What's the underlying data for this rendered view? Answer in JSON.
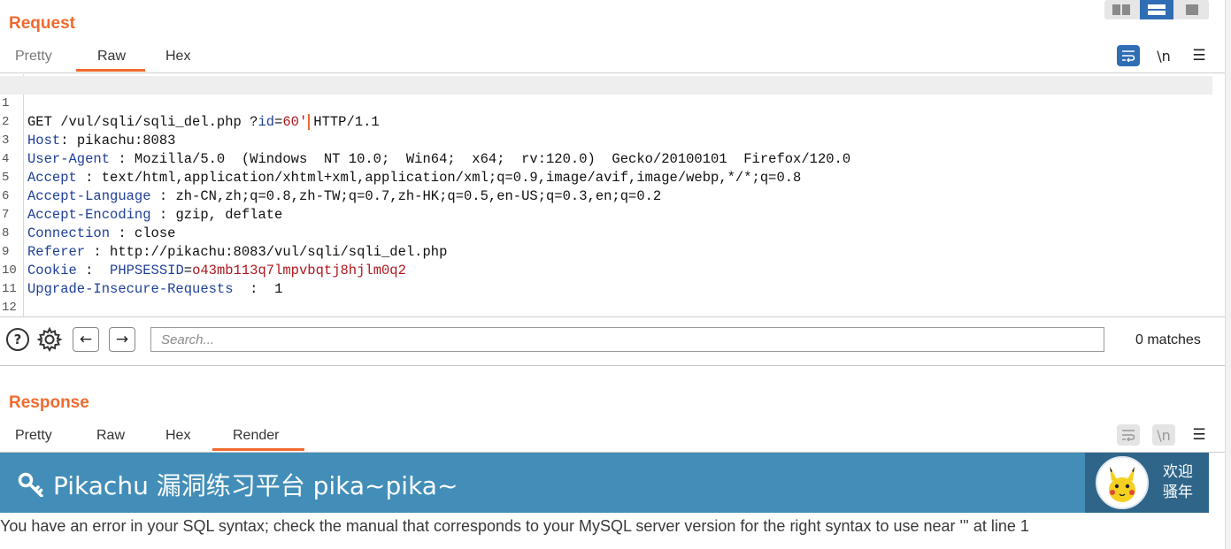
{
  "layout_toggle": {
    "options": [
      "side-by-side",
      "stacked",
      "single"
    ],
    "active": "stacked"
  },
  "request": {
    "title": "Request",
    "tabs": [
      "Pretty",
      "Raw",
      "Hex"
    ],
    "active_tab": "Raw",
    "toolbar": {
      "wrap_icon": "wrap-lines-icon",
      "newline_label": "\\n",
      "menu_label": "☰"
    },
    "lines": [
      {
        "n": "1",
        "method_path": "GET /vul/sqli/sqli_del.php ?",
        "param_key": "id",
        "eq": "=",
        "param_value": "60'",
        "after": "HTTP/1.1"
      },
      {
        "n": "2",
        "key": "Host",
        "sep": ": ",
        "value": "pikachu:8083"
      },
      {
        "n": "3",
        "key": "User-Agent",
        "sep": " : ",
        "value": "Mozilla/5.0  (Windows  NT 10.0;  Win64;  x64;  rv:120.0)  Gecko/20100101  Firefox/120.0"
      },
      {
        "n": "4",
        "key": "Accept",
        "sep": " : ",
        "value": "text/html,application/xhtml+xml,application/xml;q=0.9,image/avif,image/webp,*/*;q=0.8"
      },
      {
        "n": "5",
        "key": "Accept-Language",
        "sep": " : ",
        "value": "zh-CN,zh;q=0.8,zh-TW;q=0.7,zh-HK;q=0.5,en-US;q=0.3,en;q=0.2"
      },
      {
        "n": "6",
        "key": "Accept-Encoding",
        "sep": " : ",
        "value": "gzip, deflate"
      },
      {
        "n": "7",
        "key": "Connection",
        "sep": " : ",
        "value": "close"
      },
      {
        "n": "8",
        "key": "Referer",
        "sep": " : ",
        "value": "http://pikachu:8083/vul/sqli/sqli_del.php"
      },
      {
        "n": "9",
        "key": "Cookie",
        "sep": " :  ",
        "cookie_name": "PHPSESSID",
        "cookie_eq": "=",
        "cookie_value": "o43mb113q7lmpvbqtj8hjlm0q2"
      },
      {
        "n": "10",
        "key": "Upgrade-Insecure-Requests",
        "sep": "  :  ",
        "value": "1"
      },
      {
        "n": "11"
      },
      {
        "n": "12"
      }
    ]
  },
  "search_bar": {
    "help_label": "?",
    "settings_icon": "gear-icon",
    "prev_label": "←",
    "next_label": "→",
    "placeholder": "Search...",
    "matches": "0 matches"
  },
  "response": {
    "title": "Response",
    "tabs": [
      "Pretty",
      "Raw",
      "Hex",
      "Render"
    ],
    "active_tab": "Render",
    "toolbar": {
      "wrap_icon": "wrap-lines-icon",
      "newline_label": "\\n",
      "menu_label": "☰"
    },
    "render": {
      "banner_title": "Pikachu 漏洞练习平台 pika~pika~",
      "banner_icon": "key-icon",
      "user_line1": "欢迎",
      "user_line2": "骚年",
      "avatar_icon": "pikachu-avatar",
      "error_message": "You have an error in your SQL syntax; check the manual that corresponds to your MySQL server version for the right syntax to use near ''' at line 1",
      "colors": {
        "banner": "#438eb9",
        "user_area": "#2e6589"
      }
    }
  },
  "colors": {
    "accent": "#f06a2f",
    "active_button": "#2f6db4",
    "header_key": "#1f3f99",
    "param_value": "#b0171f"
  }
}
